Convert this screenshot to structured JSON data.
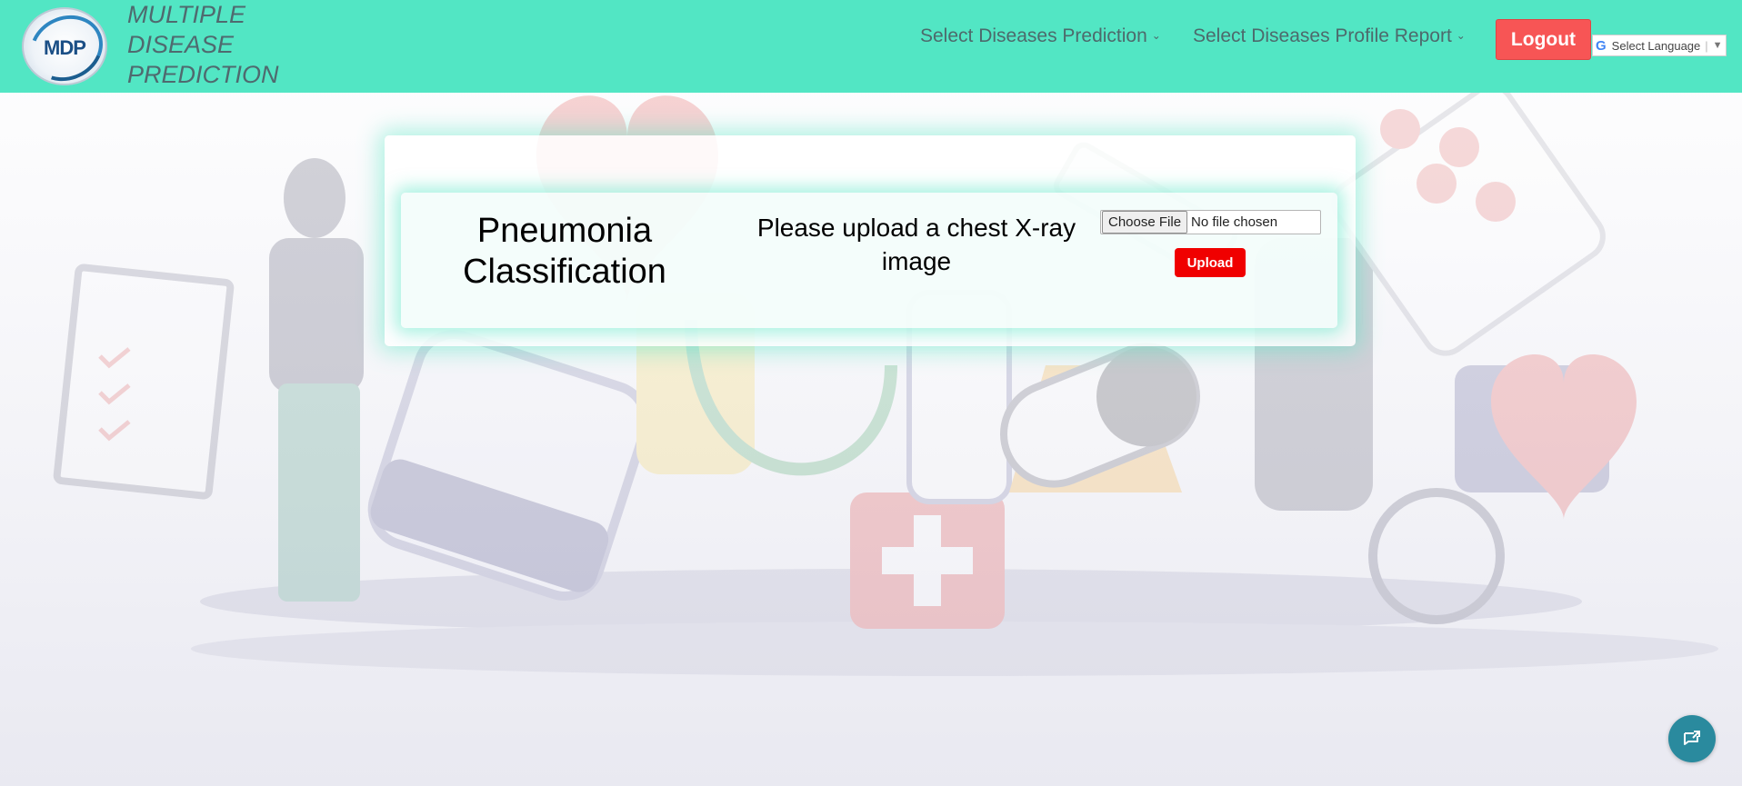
{
  "header": {
    "logo_text": "MDP",
    "brand": "MULTIPLE\nDISEASE\nPREDICTION",
    "nav": [
      {
        "label": "Select Diseases Prediction"
      },
      {
        "label": "Select Diseases Profile Report"
      }
    ],
    "logout_label": "Logout",
    "language": {
      "label": "Select Language"
    }
  },
  "main": {
    "title": "Pneumonia Classification",
    "prompt": "Please upload a chest X-ray image",
    "file_button": "Choose File",
    "file_status": "No file chosen",
    "upload_label": "Upload"
  },
  "colors": {
    "header_bg": "#52e6c4",
    "logout_bg": "#f75555",
    "upload_bg": "#f00000",
    "chat_bg": "#2a8a9e"
  },
  "icons": {
    "chevron": "chevron-down-icon",
    "google": "google-icon",
    "chat": "chat-icon"
  }
}
